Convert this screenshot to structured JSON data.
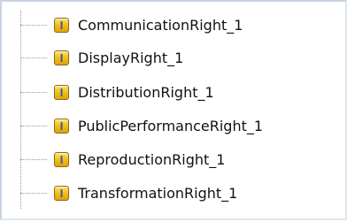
{
  "tree": {
    "items": [
      {
        "label": "CommunicationRight_1",
        "icon": "instance-icon",
        "icon_glyph": "I"
      },
      {
        "label": "DisplayRight_1",
        "icon": "instance-icon",
        "icon_glyph": "I"
      },
      {
        "label": "DistributionRight_1",
        "icon": "instance-icon",
        "icon_glyph": "I"
      },
      {
        "label": "PublicPerformanceRight_1",
        "icon": "instance-icon",
        "icon_glyph": "I"
      },
      {
        "label": "ReproductionRight_1",
        "icon": "instance-icon",
        "icon_glyph": "I"
      },
      {
        "label": "TransformationRight_1",
        "icon": "instance-icon",
        "icon_glyph": "I"
      }
    ]
  },
  "colors": {
    "icon_fill": "#f3c21a",
    "icon_letter": "#3652b7",
    "connector": "#9a9a9a"
  }
}
